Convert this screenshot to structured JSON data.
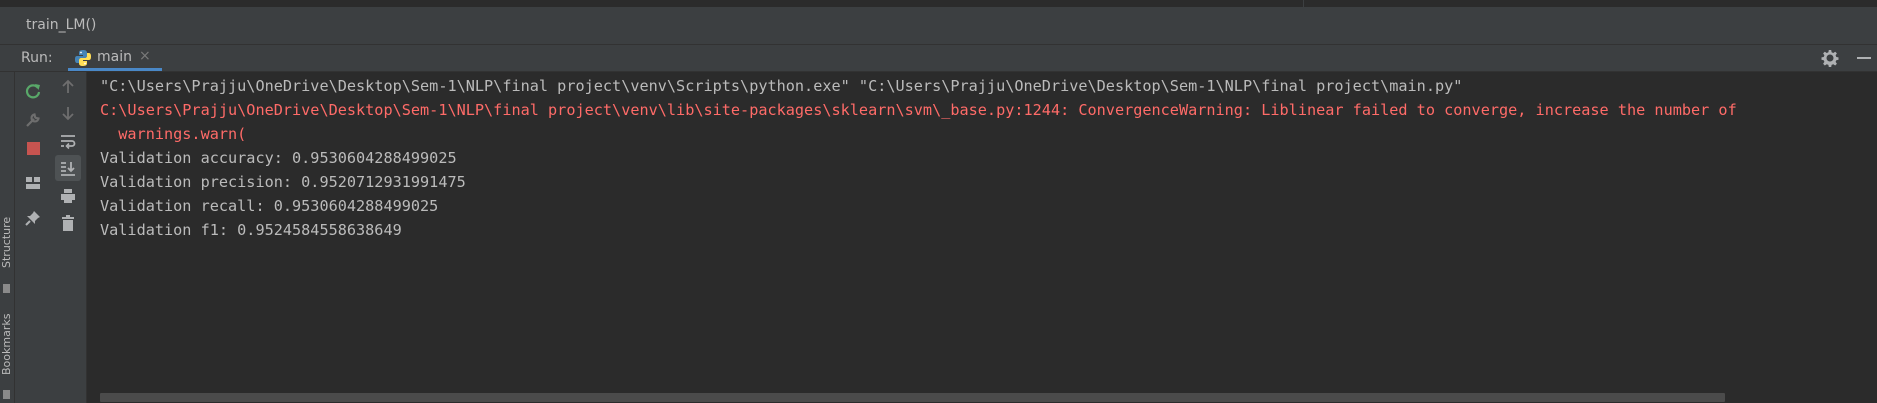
{
  "breadcrumb": {
    "function_name": "train_LM()"
  },
  "run_panel": {
    "label": "Run:",
    "tab": {
      "label": "main",
      "close": "×"
    }
  },
  "side_labels": {
    "structure": "Structure",
    "bookmarks": "Bookmarks"
  },
  "console": {
    "lines": [
      {
        "text": "\"C:\\Users\\Prajju\\OneDrive\\Desktop\\Sem-1\\NLP\\final project\\venv\\Scripts\\python.exe\" \"C:\\Users\\Prajju\\OneDrive\\Desktop\\Sem-1\\NLP\\final project\\main.py\"",
        "kind": "normal"
      },
      {
        "text": "C:\\Users\\Prajju\\OneDrive\\Desktop\\Sem-1\\NLP\\final project\\venv\\lib\\site-packages\\sklearn\\svm\\_base.py:1244: ConvergenceWarning: Liblinear failed to converge, increase the number of",
        "kind": "error"
      },
      {
        "text": "  warnings.warn(",
        "kind": "error"
      },
      {
        "text": "Validation accuracy: 0.9530604288499025",
        "kind": "normal"
      },
      {
        "text": "Validation precision: 0.9520712931991475",
        "kind": "normal"
      },
      {
        "text": "Validation recall: 0.9530604288499025",
        "kind": "normal"
      },
      {
        "text": "Validation f1: 0.9524584558638649",
        "kind": "normal"
      }
    ]
  },
  "icons": {
    "toolbar_left": [
      "rerun-icon",
      "wrench-icon",
      "stop-icon",
      "layout-icon",
      "pin-icon"
    ],
    "toolbar_right": [
      "arrow-up-icon",
      "arrow-down-icon",
      "soft-wrap-icon",
      "scroll-to-end-icon",
      "print-icon",
      "trash-icon"
    ]
  },
  "colors": {
    "background": "#2b2b2b",
    "panel": "#3c3f41",
    "text": "#bbbbbb",
    "error_text": "#ff6b68",
    "rerun_green": "#59a869",
    "stop_red": "#c75450",
    "tab_underline": "#4a88c7"
  }
}
